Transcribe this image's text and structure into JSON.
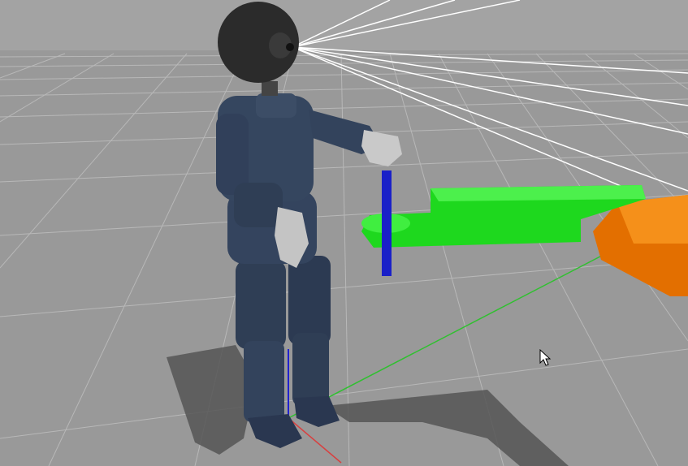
{
  "viewport": {
    "background_color": "#9a9a9a",
    "sky_color": "#a3a3a3",
    "grid_color": "#b9b9b9"
  },
  "scene_objects": {
    "robot": {
      "body_color": "#2f3e55",
      "head_color": "#2b2b2b",
      "hand_color": "#c9c9c9"
    },
    "handle_rod": {
      "color": "#1a20c8"
    },
    "lever_arm": {
      "color": "#22e022"
    },
    "base_block": {
      "color": "#f07a00"
    },
    "gaze_rays": {
      "color": "#ffffff",
      "count": 8
    },
    "axes": {
      "x_color": "#d84040",
      "y_color": "#30c030",
      "z_color": "#2020d0"
    }
  },
  "cursor": {
    "icon": "mouse-pointer-icon"
  }
}
